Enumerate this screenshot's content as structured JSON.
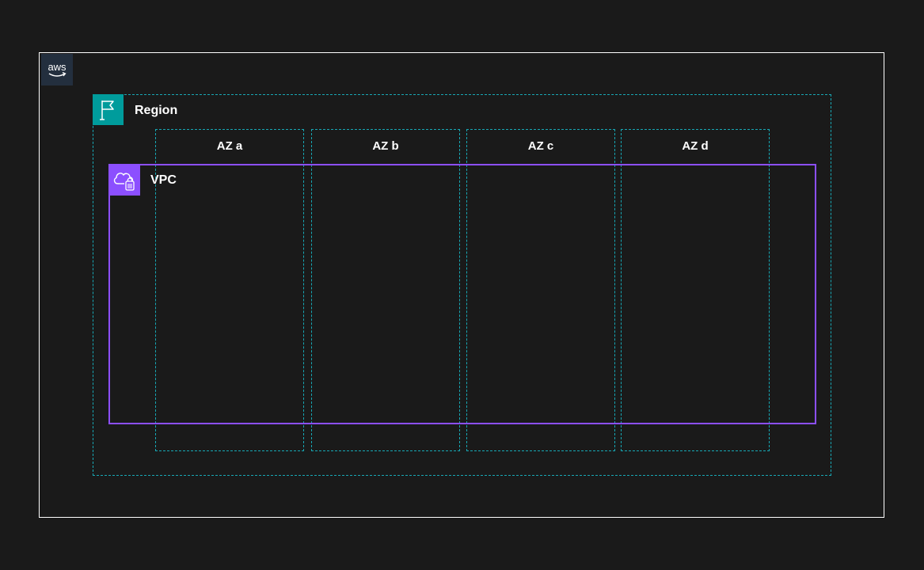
{
  "cloud": {
    "logo_text": "aws",
    "icon": "aws-logo-icon",
    "border_color": "#ffffff"
  },
  "region": {
    "label": "Region",
    "icon": "region-flag-icon",
    "color": "#009c9c"
  },
  "availability_zones": [
    {
      "label": "AZ a"
    },
    {
      "label": "AZ b"
    },
    {
      "label": "AZ c"
    },
    {
      "label": "AZ d"
    }
  ],
  "vpc": {
    "label": "VPC",
    "icon": "vpc-cloud-lock-icon",
    "color": "#8c4fff"
  },
  "colors": {
    "background": "#1a1a1a",
    "az_border": "#17a8b5"
  }
}
